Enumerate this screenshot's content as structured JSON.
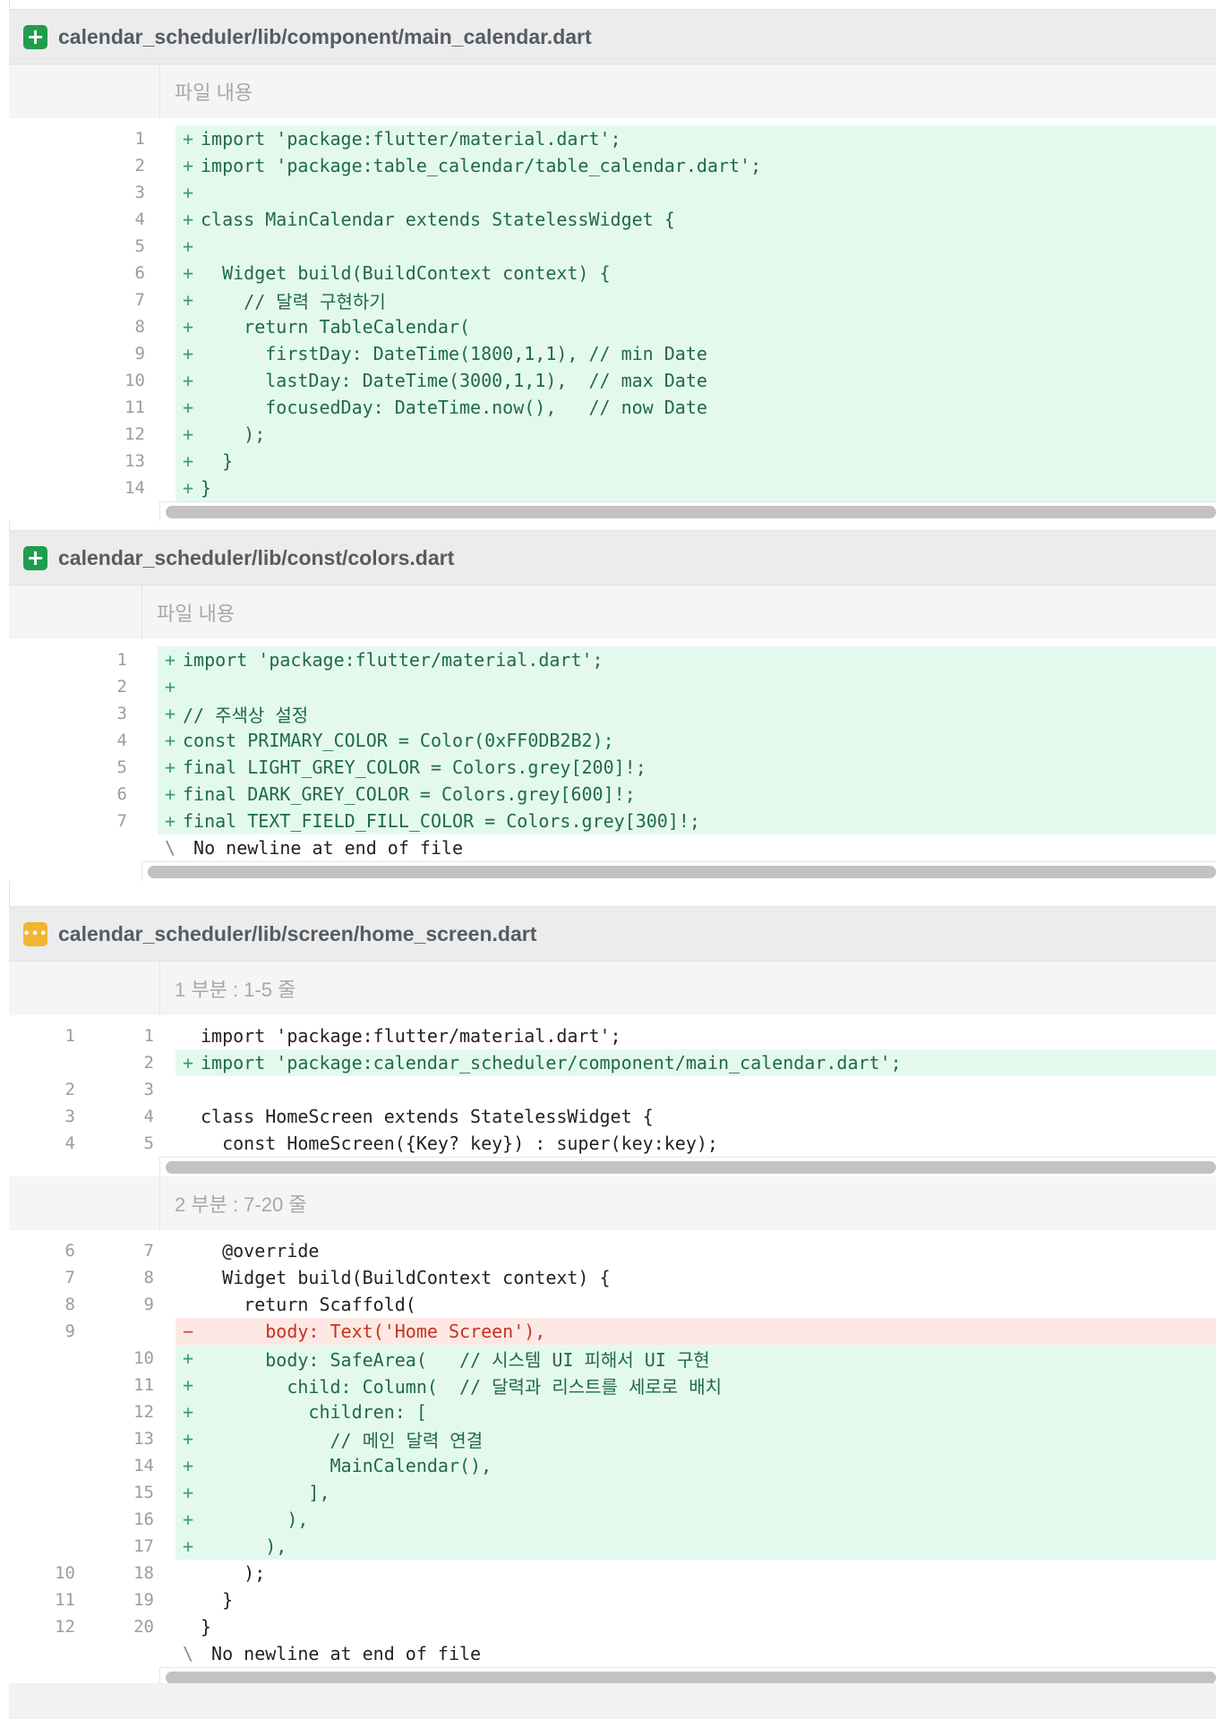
{
  "files": [
    {
      "path": "calendar_scheduler/lib/component/main_calendar.dart",
      "status": "added",
      "status_icon": "plus-icon",
      "hunks": [
        {
          "label": "파일 내용",
          "lines": [
            {
              "type": "add",
              "new": "1",
              "text": "import 'package:flutter/material.dart';"
            },
            {
              "type": "add",
              "new": "2",
              "text": "import 'package:table_calendar/table_calendar.dart';"
            },
            {
              "type": "add",
              "new": "3",
              "text": ""
            },
            {
              "type": "add",
              "new": "4",
              "text": "class MainCalendar extends StatelessWidget {"
            },
            {
              "type": "add",
              "new": "5",
              "text": ""
            },
            {
              "type": "add",
              "new": "6",
              "text": "  Widget build(BuildContext context) {"
            },
            {
              "type": "add",
              "new": "7",
              "text": "    // 달력 구현하기"
            },
            {
              "type": "add",
              "new": "8",
              "text": "    return TableCalendar("
            },
            {
              "type": "add",
              "new": "9",
              "text": "      firstDay: DateTime(1800,1,1), // min Date"
            },
            {
              "type": "add",
              "new": "10",
              "text": "      lastDay: DateTime(3000,1,1),  // max Date"
            },
            {
              "type": "add",
              "new": "11",
              "text": "      focusedDay: DateTime.now(),   // now Date"
            },
            {
              "type": "add",
              "new": "12",
              "text": "    );"
            },
            {
              "type": "add",
              "new": "13",
              "text": "  }"
            },
            {
              "type": "add",
              "new": "14",
              "text": "}"
            }
          ]
        }
      ]
    },
    {
      "path": "calendar_scheduler/lib/const/colors.dart",
      "status": "added",
      "status_icon": "plus-icon",
      "hunks": [
        {
          "label": "파일 내용",
          "lines": [
            {
              "type": "add",
              "new": "1",
              "text": "import 'package:flutter/material.dart';"
            },
            {
              "type": "add",
              "new": "2",
              "text": ""
            },
            {
              "type": "add",
              "new": "3",
              "text": "// 주색상 설정"
            },
            {
              "type": "add",
              "new": "4",
              "text": "const PRIMARY_COLOR = Color(0xFF0DB2B2);"
            },
            {
              "type": "add",
              "new": "5",
              "text": "final LIGHT_GREY_COLOR = Colors.grey[200]!;"
            },
            {
              "type": "add",
              "new": "6",
              "text": "final DARK_GREY_COLOR = Colors.grey[600]!;"
            },
            {
              "type": "add",
              "new": "7",
              "text": "final TEXT_FIELD_FILL_COLOR = Colors.grey[300]!;"
            },
            {
              "type": "meta",
              "new": "",
              "text": " No newline at end of file",
              "sign": "\\"
            }
          ]
        }
      ]
    },
    {
      "path": "calendar_scheduler/lib/screen/home_screen.dart",
      "status": "modified",
      "status_icon": "ellipsis-icon",
      "hunks": [
        {
          "label": "1 부분 : 1-5 줄",
          "lines": [
            {
              "type": "ctx",
              "old": "1",
              "new": "1",
              "text": "import 'package:flutter/material.dart';"
            },
            {
              "type": "add",
              "old": "",
              "new": "2",
              "text": "import 'package:calendar_scheduler/component/main_calendar.dart';"
            },
            {
              "type": "ctx",
              "old": "2",
              "new": "3",
              "text": ""
            },
            {
              "type": "ctx",
              "old": "3",
              "new": "4",
              "text": "class HomeScreen extends StatelessWidget {"
            },
            {
              "type": "ctx",
              "old": "4",
              "new": "5",
              "text": "  const HomeScreen({Key? key}) : super(key:key);"
            }
          ]
        },
        {
          "label": "2 부분 : 7-20 줄",
          "lines": [
            {
              "type": "ctx",
              "old": "6",
              "new": "7",
              "text": "  @override"
            },
            {
              "type": "ctx",
              "old": "7",
              "new": "8",
              "text": "  Widget build(BuildContext context) {"
            },
            {
              "type": "ctx",
              "old": "8",
              "new": "9",
              "text": "    return Scaffold("
            },
            {
              "type": "del",
              "old": "9",
              "new": "",
              "text": "      body: Text('Home Screen'),"
            },
            {
              "type": "add",
              "old": "",
              "new": "10",
              "text": "      body: SafeArea(   // 시스템 UI 피해서 UI 구현"
            },
            {
              "type": "add",
              "old": "",
              "new": "11",
              "text": "        child: Column(  // 달력과 리스트를 세로로 배치"
            },
            {
              "type": "add",
              "old": "",
              "new": "12",
              "text": "          children: ["
            },
            {
              "type": "add",
              "old": "",
              "new": "13",
              "text": "            // 메인 달력 연결"
            },
            {
              "type": "add",
              "old": "",
              "new": "14",
              "text": "            MainCalendar(),"
            },
            {
              "type": "add",
              "old": "",
              "new": "15",
              "text": "          ],"
            },
            {
              "type": "add",
              "old": "",
              "new": "16",
              "text": "        ),"
            },
            {
              "type": "add",
              "old": "",
              "new": "17",
              "text": "      ),"
            },
            {
              "type": "ctx",
              "old": "10",
              "new": "18",
              "text": "    );"
            },
            {
              "type": "ctx",
              "old": "11",
              "new": "19",
              "text": "  }"
            },
            {
              "type": "ctx",
              "old": "12",
              "new": "20",
              "text": "}"
            },
            {
              "type": "meta",
              "old": "",
              "new": "",
              "text": " No newline at end of file",
              "sign": "\\"
            }
          ]
        }
      ]
    }
  ]
}
